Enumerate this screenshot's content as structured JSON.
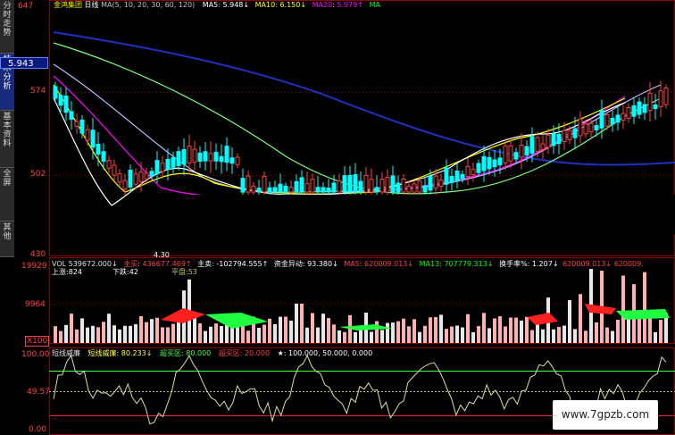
{
  "sidebar": {
    "tabs": [
      {
        "label": "分时走势",
        "active": false
      },
      {
        "label": "技术分析",
        "active": true
      },
      {
        "label": "基本资料",
        "active": false
      },
      {
        "label": "全屏",
        "active": false
      },
      {
        "label": "其他",
        "active": false
      }
    ]
  },
  "price_panel": {
    "title": "金鸿集团",
    "period": "日线",
    "ma_params": "MA(5, 10, 20, 30, 60, 120)",
    "ma_items": [
      {
        "label": "MA5",
        "value": "5.948↓",
        "color": "#ffffff"
      },
      {
        "label": "MA10",
        "value": "6.150↓",
        "color": "#ffff00"
      },
      {
        "label": "MA20",
        "value": "5.979↑",
        "color": "#ff00ff"
      },
      {
        "label": "MA",
        "value": "",
        "color": "#00ff00"
      }
    ],
    "axis": {
      "top": "647",
      "upper": "574",
      "mid": "502",
      "bottom": "430"
    },
    "current_price": "5.943",
    "low_marker": "4.30"
  },
  "volume_panel": {
    "vol_label": "VOL 539672.000↓",
    "zhu_mai_label": "主买",
    "zhu_mai_value": "436677.469↑",
    "zhu_mai_sell_label": "主卖",
    "zhu_mai_sell_value": "-102794.555↑",
    "fund_label": "资金异动: 93.380↓",
    "ma5_label": "MA5",
    "ma5_value": "620009.013↓",
    "ma13_label": "MA13",
    "ma13_value": "707779.313↓",
    "turnover_label": "换手率%: 1.207↓",
    "extra1": "620009.013↓",
    "extra2": "620009.",
    "up_count": "上涨:824",
    "down_count": "下跌:42",
    "flat_count": "平盘:53",
    "axis": {
      "top": "19929",
      "mid": "9964",
      "bottom": "X100"
    }
  },
  "indicator_panel": {
    "name": "短线威廉",
    "line_label": "短线威廉: 80.233↓",
    "overbuy": "超买区: 80.000",
    "oversell": "超买区: 20.000",
    "star_label": "★: 100.000, 50.000, 0.000",
    "axis": {
      "top": "100.00",
      "mid": "49.57",
      "bottom": "0.00"
    }
  },
  "watermark": "www.7gpzb.com",
  "colors": {
    "grid": "#8b0000",
    "up_candle": "#ff4040",
    "down_candle": "#00ffff",
    "ma120": "#2030c0",
    "ma60": "#80ff80",
    "ma30": "#c0c0ff",
    "williams_line": "#e0e0a0"
  }
}
